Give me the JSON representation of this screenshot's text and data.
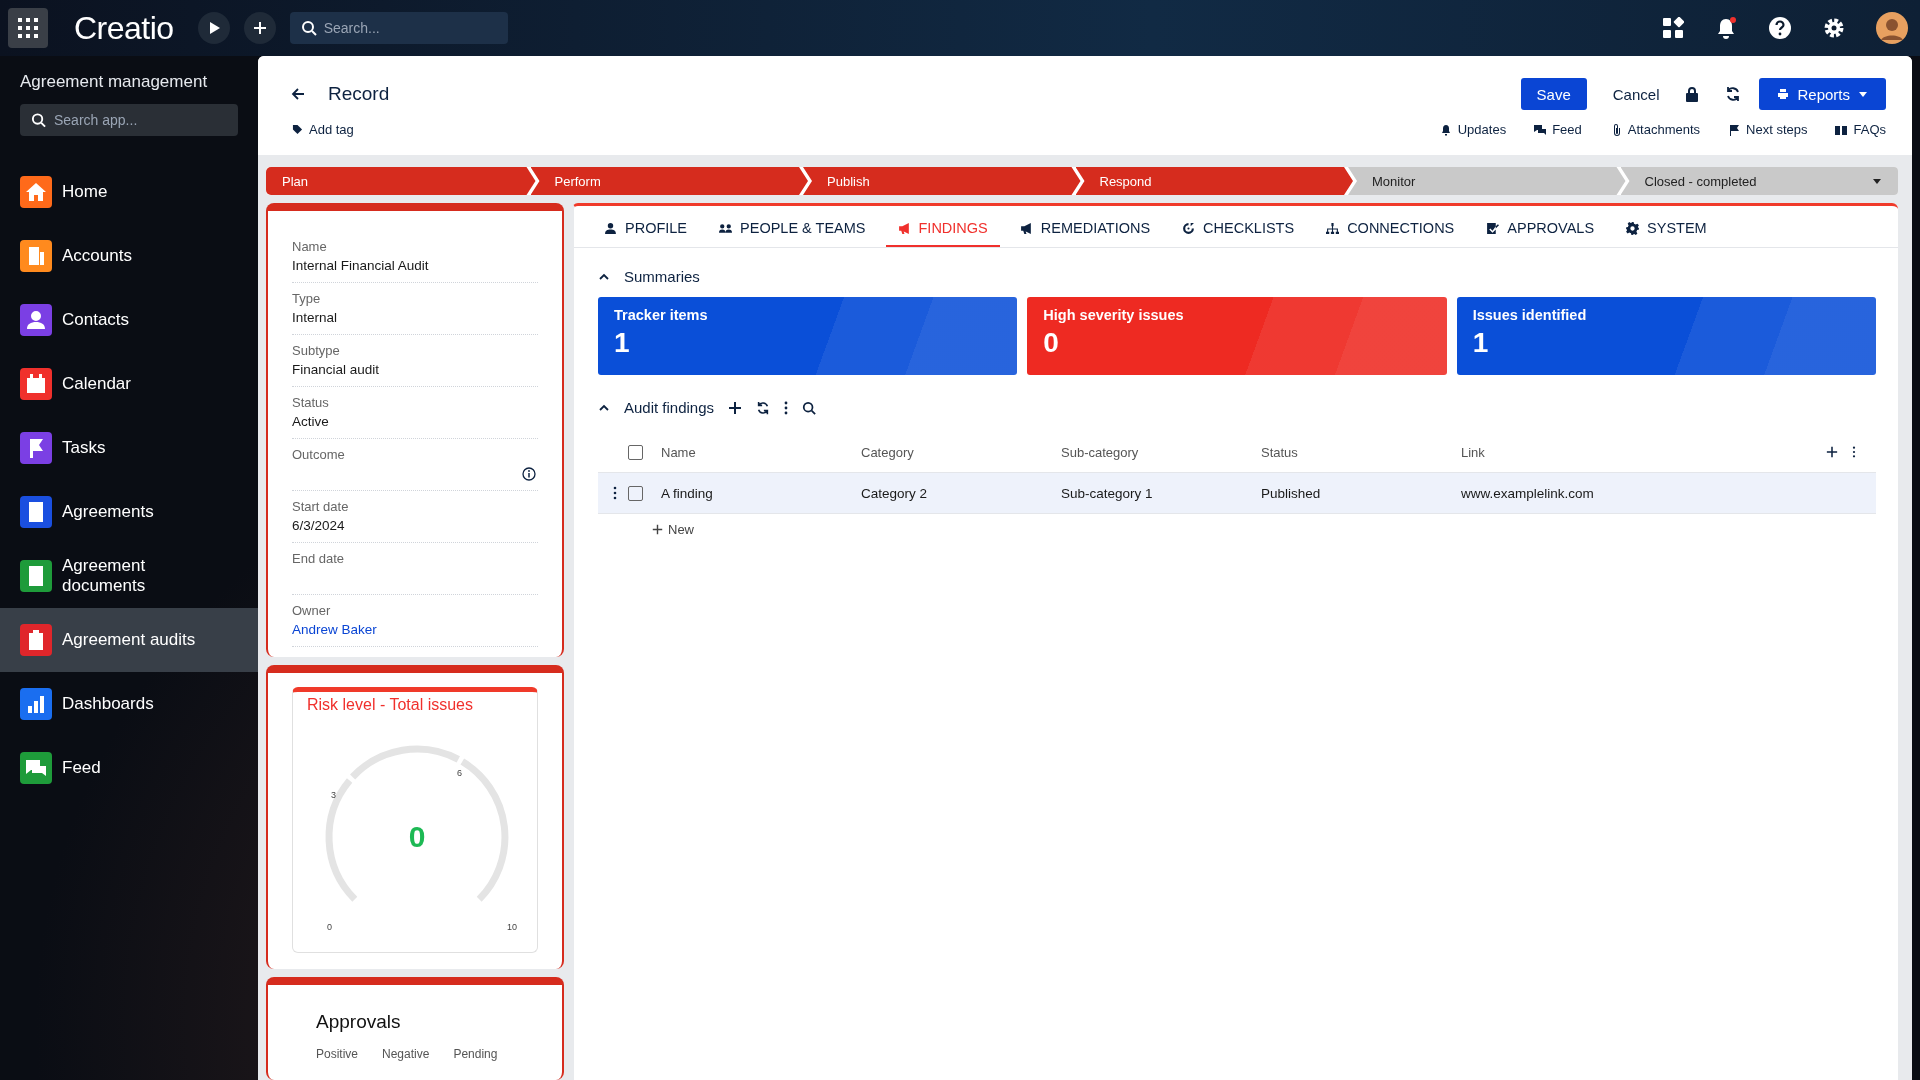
{
  "topbar": {
    "logo": "Creatio",
    "search": {
      "placeholder": "Search..."
    }
  },
  "sidebar": {
    "title": "Agreement management",
    "search": {
      "placeholder": "Search app..."
    },
    "items": [
      {
        "label": "Home",
        "color": "#ff6a1a",
        "selected": false
      },
      {
        "label": "Accounts",
        "color": "#ff8a1e",
        "selected": false
      },
      {
        "label": "Contacts",
        "color": "#7b3fe4",
        "selected": false
      },
      {
        "label": "Calendar",
        "color": "#f0302c",
        "selected": false
      },
      {
        "label": "Tasks",
        "color": "#7b3fe4",
        "selected": false
      },
      {
        "label": "Agreements",
        "color": "#1a4fe0",
        "selected": false
      },
      {
        "label": "Agreement documents",
        "color": "#1e9b3a",
        "selected": false
      },
      {
        "label": "Agreement audits",
        "color": "#e0262b",
        "selected": true
      },
      {
        "label": "Dashboards",
        "color": "#1a6ef0",
        "selected": false
      },
      {
        "label": "Feed",
        "color": "#1e9b3a",
        "selected": false
      }
    ]
  },
  "header": {
    "title": "Record",
    "add_tag": "Add tag",
    "buttons": {
      "save": "Save",
      "cancel": "Cancel",
      "reports": "Reports"
    },
    "links": [
      "Updates",
      "Feed",
      "Attachments",
      "Next steps",
      "FAQs"
    ]
  },
  "stages": [
    {
      "label": "Plan",
      "done": true
    },
    {
      "label": "Perform",
      "done": true
    },
    {
      "label": "Publish",
      "done": true
    },
    {
      "label": "Respond",
      "done": true
    },
    {
      "label": "Monitor",
      "done": false
    },
    {
      "label": "Closed - completed",
      "done": false
    }
  ],
  "fields": [
    {
      "label": "Name",
      "value": "Internal Financial Audit",
      "kind": "text"
    },
    {
      "label": "Type",
      "value": "Internal",
      "kind": "text"
    },
    {
      "label": "Subtype",
      "value": "Financial audit",
      "kind": "text"
    },
    {
      "label": "Status",
      "value": "Active",
      "kind": "text"
    },
    {
      "label": "Outcome",
      "kind": "info"
    },
    {
      "label": "Start date",
      "value": "6/3/2024",
      "kind": "text"
    },
    {
      "label": "End date",
      "kind": "text"
    },
    {
      "label": "Owner",
      "value": "Andrew Baker",
      "kind": "link"
    }
  ],
  "gauge": {
    "title": "Risk level - Total issues",
    "value": "0",
    "ticks": [
      "0",
      "3",
      "6",
      "10"
    ]
  },
  "approvals": {
    "title": "Approvals",
    "columns": [
      "Positive",
      "Negative",
      "Pending"
    ]
  },
  "tabs": [
    {
      "label": "PROFILE",
      "selected": false
    },
    {
      "label": "PEOPLE & TEAMS",
      "selected": false
    },
    {
      "label": "FINDINGS",
      "selected": true
    },
    {
      "label": "REMEDIATIONS",
      "selected": false
    },
    {
      "label": "CHECKLISTS",
      "selected": false
    },
    {
      "label": "CONNECTIONS",
      "selected": false
    },
    {
      "label": "APPROVALS",
      "selected": false
    },
    {
      "label": "SYSTEM",
      "selected": false
    }
  ],
  "summaries": {
    "title": "Summaries",
    "expanded": true,
    "cards": [
      {
        "label": "Tracker items",
        "value": "1",
        "color": "#0a4fd8"
      },
      {
        "label": "High severity issues",
        "value": "0",
        "color": "#ee2a22"
      },
      {
        "label": "Issues identified",
        "value": "1",
        "color": "#0a4fd8"
      }
    ]
  },
  "findings": {
    "title": "Audit findings",
    "expanded": true,
    "select_all_checked": false,
    "columns": [
      "Name",
      "Category",
      "Sub-category",
      "Status",
      "Link"
    ],
    "rows": [
      {
        "cells": [
          "A finding",
          "Category 2",
          "Sub-category 1",
          "Published",
          "www.examplelink.com"
        ],
        "checked": false
      }
    ],
    "new": "New"
  }
}
